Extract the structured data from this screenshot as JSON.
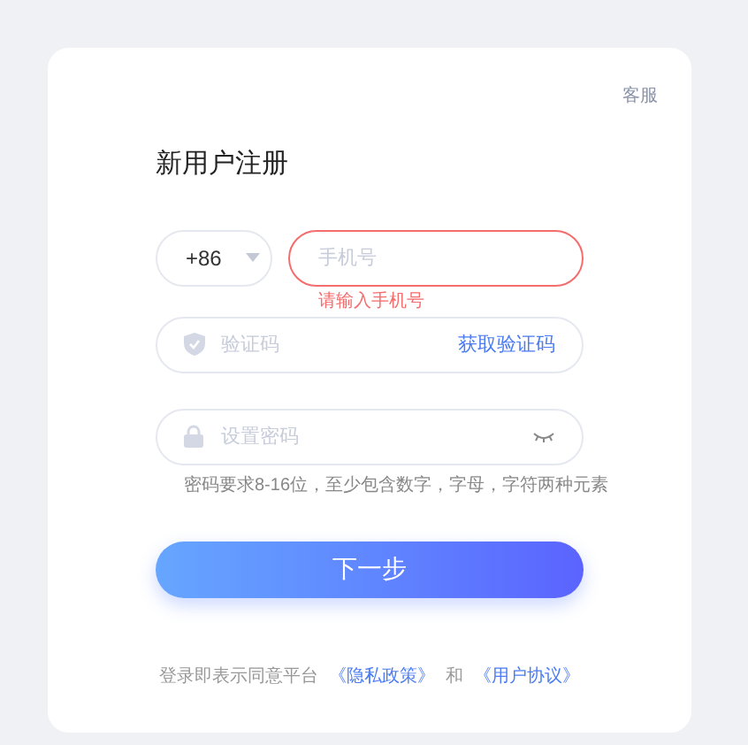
{
  "support_link": "客服",
  "title": "新用户注册",
  "country_code": "+86",
  "phone": {
    "placeholder": "手机号",
    "error": "请输入手机号",
    "invalid": true
  },
  "code": {
    "placeholder": "验证码",
    "action": "获取验证码"
  },
  "password": {
    "placeholder": "设置密码",
    "hint": "密码要求8-16位，至少包含数字，字母，字符两种元素"
  },
  "submit": "下一步",
  "footer": {
    "text": "登录即表示同意平台",
    "privacy": "《隐私政策》",
    "and": "和",
    "terms": "《用户协议》"
  }
}
